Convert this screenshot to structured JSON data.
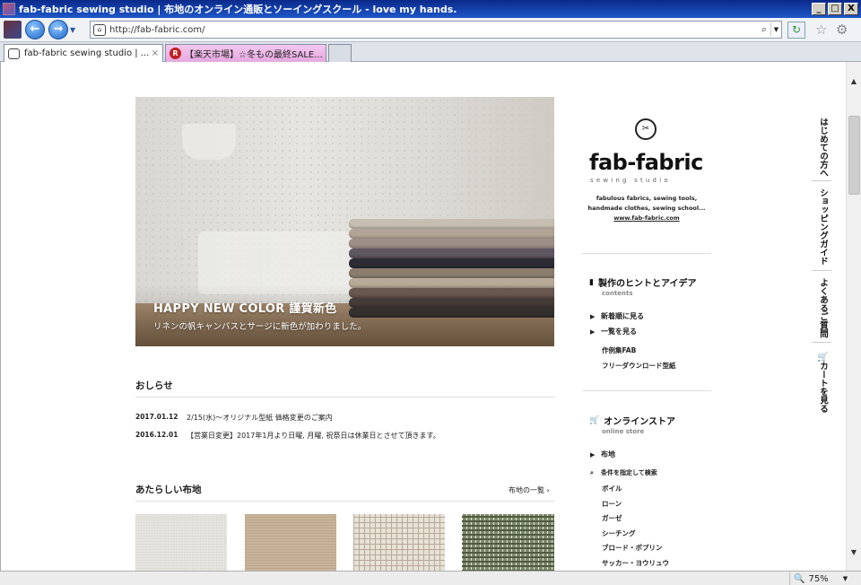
{
  "window": {
    "title": "fab-fabric sewing studio | 布地のオンライン通販とソーイングスクール - love my hands.",
    "min_glyph": "_",
    "max_glyph": "□",
    "close_glyph": "X"
  },
  "toolbar": {
    "back_glyph": "←",
    "forward_glyph": "→",
    "url": "http://fab-fabric.com/",
    "search_glyph": "⌕",
    "dropdown_glyph": "▼",
    "refresh_glyph": "↻",
    "favorites_glyph": "☆",
    "tools_glyph": "⚙"
  },
  "tabs": [
    {
      "label": "fab-fabric sewing studio | ...",
      "close_glyph": "×",
      "active": true
    },
    {
      "label": "【楽天市場】☆冬もの最終SALE...",
      "badge": "R",
      "active": false
    }
  ],
  "hero": {
    "title": "HAPPY NEW COLOR 謹賀新色",
    "subtitle": "リネンの帆キャンバスとサージに新色が加わりました。"
  },
  "news": {
    "title": "おしらせ",
    "items": [
      {
        "date": "2017.01.12",
        "text": "2/15(水)～オリジナル型紙 価格変更のご案内"
      },
      {
        "date": "2016.12.01",
        "text": "【営業日変更】2017年1月より日曜, 月曜, 祝祭日は休業日とさせて頂きます。"
      }
    ]
  },
  "new_fabrics": {
    "title": "あたらしい布地",
    "more_label": "布地の一覧 ›"
  },
  "brand": {
    "icon_glyph": "✂",
    "name": "fab-fabric",
    "sub": "sewing studio",
    "tagline_1": "fabulous fabrics, sewing tools,",
    "tagline_2": "handmade clothes, sewing school...",
    "url": "www.fab-fabric.com"
  },
  "contents": {
    "icon_glyph": "▮",
    "title": "製作のヒントとアイデア",
    "en": "contents",
    "items": [
      {
        "label": "新着順に見る"
      },
      {
        "label": "一覧を見る"
      }
    ],
    "links": [
      "作例集FAB",
      "フリーダウンロード型紙"
    ]
  },
  "store": {
    "icon_glyph": "🛒",
    "title": "オンラインストア",
    "en": "online store",
    "item": "布地",
    "search_label": "条件を指定して検索",
    "search_glyph": "⌕",
    "categories": [
      "ボイル",
      "ローン",
      "ガーゼ",
      "シーチング",
      "ブロード・ポプリン",
      "サッカー・ヨウリュウ"
    ]
  },
  "vnav": {
    "beginners": "はじめての方へ",
    "shopping_guide": "ショッピングガイド",
    "faq": "よくあるご質問",
    "cart": "カートを見る",
    "cart_glyph": "🛒"
  },
  "scrollbar": {
    "up_glyph": "▲",
    "down_glyph": "▼"
  },
  "status": {
    "zoom": "75%",
    "zoom_glyph": "🔍",
    "dropdown_glyph": "▼"
  },
  "colors": {
    "titlebar": "#1f57c9",
    "tab_highlight": "#e6a8e0"
  }
}
